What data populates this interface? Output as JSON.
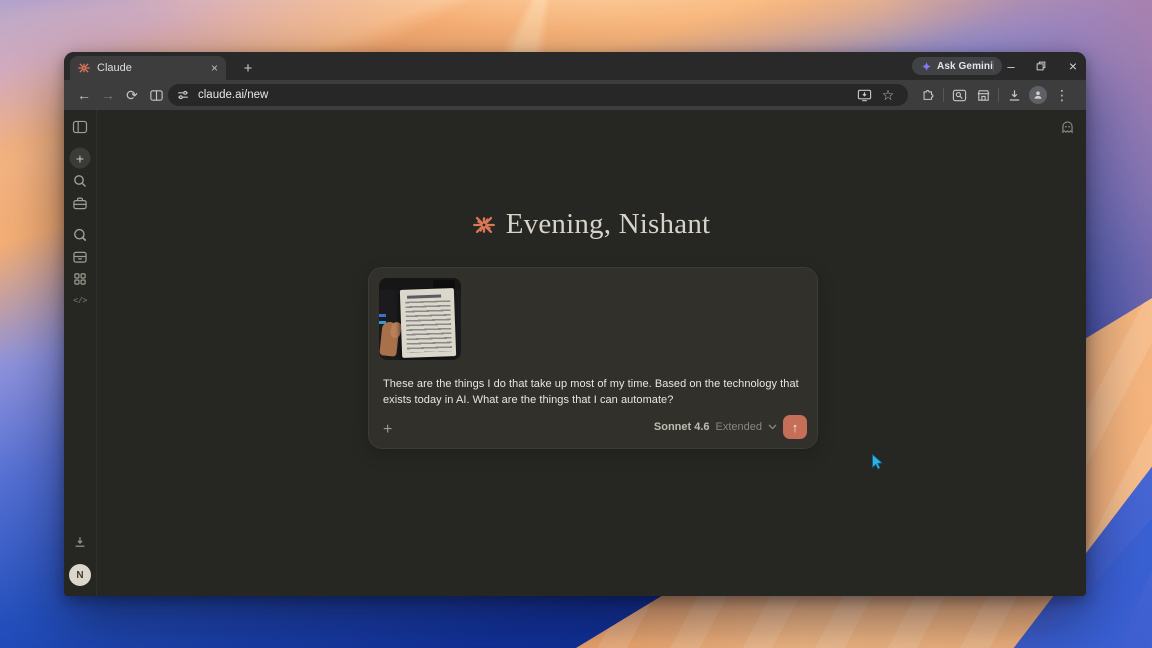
{
  "colors": {
    "accent_orange": "#d97757",
    "send_button": "#c66f58",
    "page_background": "#262623",
    "composer_background": "#31302b",
    "chrome_toolbar": "#3e3d3d",
    "chrome_tabstrip": "#292929",
    "wallpaper_blue": "#2450bd",
    "wallpaper_orange": "#ee9a63",
    "wallpaper_purple": "#988dd1"
  },
  "browser": {
    "tab_title": "Claude",
    "url": "claude.ai/new",
    "ask_gemini_label": "Ask Gemini"
  },
  "glyphs": {
    "tab_close": "×",
    "new_tab": "+",
    "minimize": "–",
    "window_close": "×",
    "back": "←",
    "forward": "→",
    "reload": "⟳",
    "star": "☆",
    "menu": "⋮",
    "new_chat": "+",
    "code": "</>",
    "attach": "+",
    "send": "↑"
  },
  "claude": {
    "greeting": "Evening, Nishant",
    "prompt": "These are the things I do that take up most of my time. Based on the technology that exists today in AI. What are the things that I can automate?",
    "model": "Sonnet 4.6",
    "mode": "Extended",
    "sidebar_avatar_initial": "N",
    "attachment_description": "Photo of a hand holding a notebook page with a handwritten list"
  }
}
